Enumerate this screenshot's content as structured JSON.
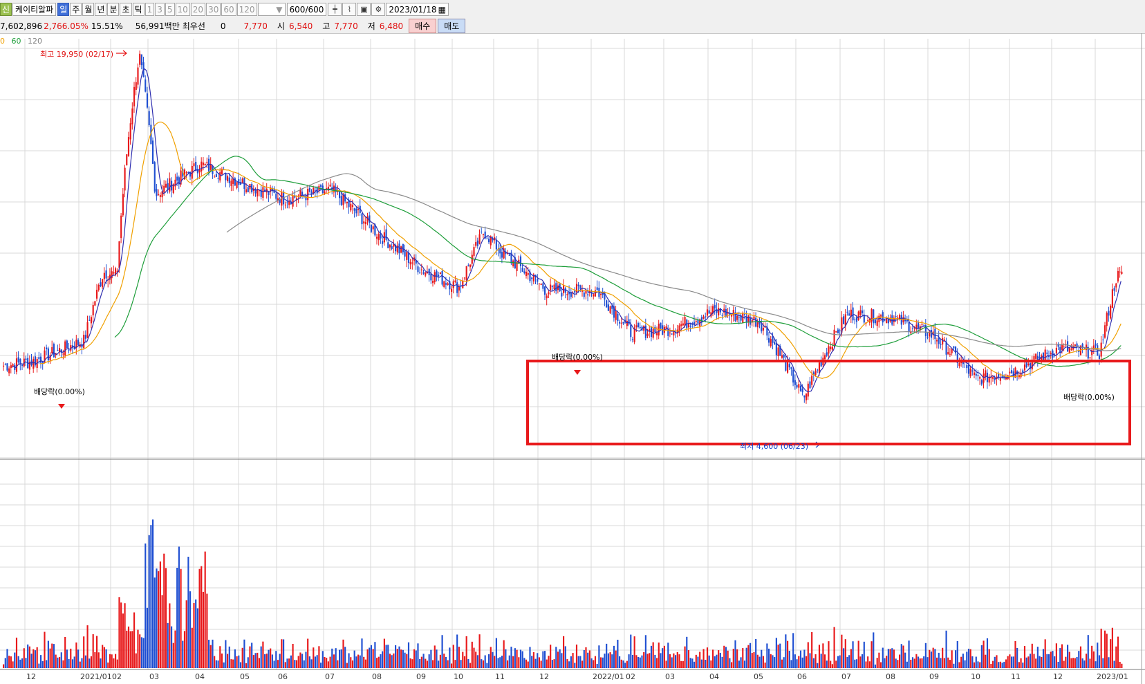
{
  "toolbar": {
    "badge": "신",
    "stock_name": "케이티알파",
    "period_tabs": [
      "일",
      "주",
      "월",
      "년",
      "분",
      "초",
      "틱"
    ],
    "minute_tabs": [
      "1",
      "3",
      "5",
      "10",
      "20",
      "30",
      "60",
      "120"
    ],
    "count": "600",
    "count_total": "/600",
    "date": "2023/01/18"
  },
  "quote": {
    "volume": "7,602,896",
    "volume_change": "2,766.05%",
    "turnover": "15.51%",
    "amount": "56,991백만",
    "best_label": "최우선",
    "best_value": "0",
    "price": "7,770",
    "open_label": "시",
    "open": "6,540",
    "high_label": "고",
    "high": "7,770",
    "low_label": "저",
    "low": "6,480",
    "buy_label": "매수",
    "sell_label": "매도"
  },
  "legend": {
    "ma_a": "0",
    "ma_b": "60",
    "ma_c": "120"
  },
  "annotations": {
    "high_marker": "최고 19,950 (02/17)",
    "low_marker": "최저 4,600 (06/23)",
    "dividend_1": "배당락(0.00%)",
    "dividend_2": "배당락(0.00%)",
    "dividend_3": "배당락(0.00%)"
  },
  "colors": {
    "up": "#e8191b",
    "down": "#1f4fd2",
    "ma5": "#2f2fb0",
    "ma20": "#f0a000",
    "ma60": "#1e9e3a",
    "ma120": "#8a8a8a",
    "highlight": "#e8191b"
  },
  "chart_data": {
    "type": "candlestick",
    "x_tick_labels": [
      "12",
      "2021/01",
      "02",
      "03",
      "04",
      "05",
      "06",
      "07",
      "08",
      "09",
      "10",
      "11",
      "12",
      "2022/01",
      "02",
      "03",
      "04",
      "05",
      "06",
      "07",
      "08",
      "09",
      "10",
      "11",
      "12",
      "2023/01"
    ],
    "price_anchors": [
      [
        "2020-12",
        5400
      ],
      [
        "2021-01",
        5900
      ],
      [
        "2021-01",
        7900
      ],
      [
        "2021-02",
        7800
      ],
      [
        "2021-02",
        19950
      ],
      [
        "2021-03",
        11000
      ],
      [
        "2021-04",
        12500
      ],
      [
        "2021-05",
        11500
      ],
      [
        "2021-06",
        10800
      ],
      [
        "2021-07",
        11200
      ],
      [
        "2021-08",
        9300
      ],
      [
        "2021-09",
        8000
      ],
      [
        "2021-10",
        7400
      ],
      [
        "2021-10",
        9400
      ],
      [
        "2021-11",
        8600
      ],
      [
        "2021-12",
        7300
      ],
      [
        "2022-01",
        7300
      ],
      [
        "2022-02",
        6100
      ],
      [
        "2022-03",
        6200
      ],
      [
        "2022-04",
        6700
      ],
      [
        "2022-05",
        6400
      ],
      [
        "2022-06",
        4600
      ],
      [
        "2022-07",
        6600
      ],
      [
        "2022-08",
        6500
      ],
      [
        "2022-09",
        6000
      ],
      [
        "2022-10",
        5000
      ],
      [
        "2022-11",
        5200
      ],
      [
        "2022-12",
        5700
      ],
      [
        "2023-01",
        5600
      ],
      [
        "2023-01",
        7770
      ]
    ]
  }
}
